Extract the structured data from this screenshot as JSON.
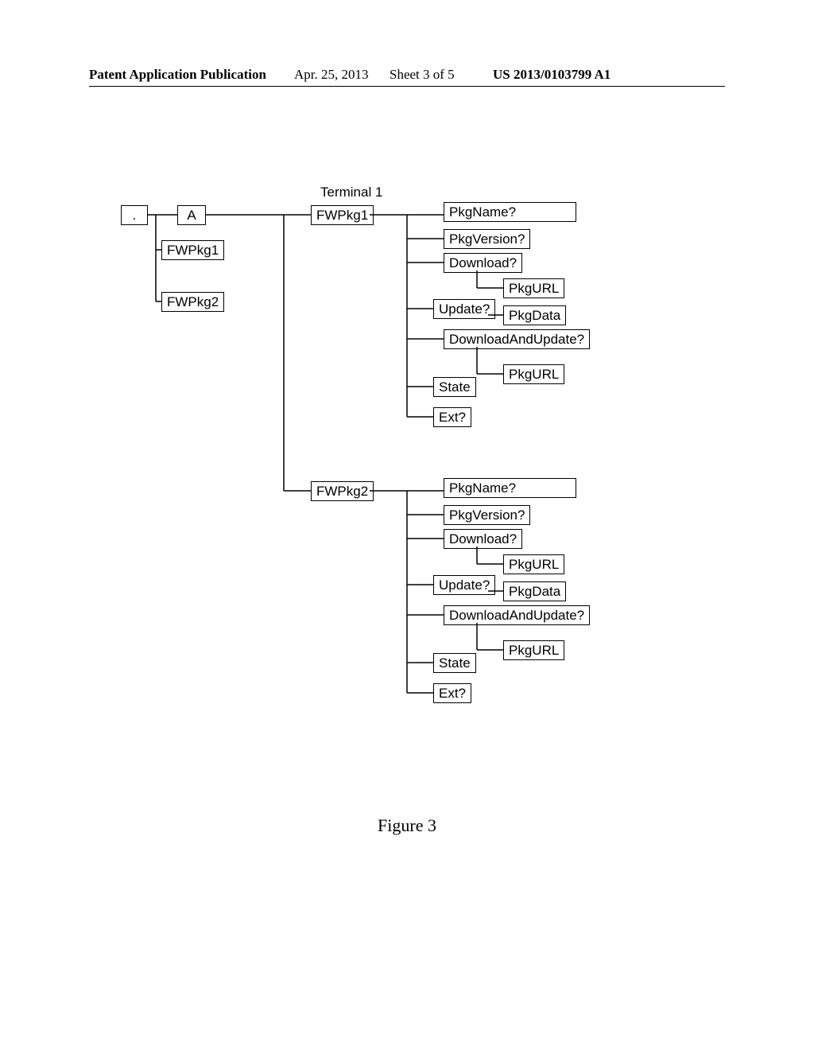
{
  "header": {
    "publication": "Patent Application Publication",
    "date": "Apr. 25, 2013",
    "sheet": "Sheet 3 of 5",
    "number": "US 2013/0103799 A1"
  },
  "chart_data": {
    "type": "tree",
    "title": "Terminal 1",
    "root": {
      "label": ".",
      "children": [
        {
          "label": "A",
          "children": [
            {
              "label": "FWPkg1"
            },
            {
              "label": "FWPkg2"
            }
          ]
        },
        {
          "label": "FWPkg1",
          "children": [
            {
              "label": "PkgName?"
            },
            {
              "label": "PkgVersion?"
            },
            {
              "label": "Download?",
              "children": [
                {
                  "label": "PkgURL"
                }
              ]
            },
            {
              "label": "Update?",
              "children": [
                {
                  "label": "PkgData"
                }
              ]
            },
            {
              "label": "DownloadAndUpdate?",
              "children": [
                {
                  "label": "PkgURL"
                }
              ]
            },
            {
              "label": "State"
            },
            {
              "label": "Ext?"
            }
          ]
        },
        {
          "label": "FWPkg2",
          "children": [
            {
              "label": "PkgName?"
            },
            {
              "label": "PkgVersion?"
            },
            {
              "label": "Download?",
              "children": [
                {
                  "label": "PkgURL"
                }
              ]
            },
            {
              "label": "Update?",
              "children": [
                {
                  "label": "PkgData"
                }
              ]
            },
            {
              "label": "DownloadAndUpdate?",
              "children": [
                {
                  "label": "PkgURL"
                }
              ]
            },
            {
              "label": "State"
            },
            {
              "label": "Ext?"
            }
          ]
        }
      ]
    }
  },
  "labels": {
    "terminal": "Terminal 1",
    "root": ".",
    "A": "A",
    "fwpkg1": "FWPkg1",
    "fwpkg2": "FWPkg2",
    "pkgname": "PkgName?",
    "pkgversion": "PkgVersion?",
    "download": "Download?",
    "pkgurl": "PkgURL",
    "update": "Update?",
    "pkgdata": "PkgData",
    "downloadAndUpdate": "DownloadAndUpdate?",
    "state": "State",
    "ext": "Ext?"
  },
  "caption": "Figure 3"
}
